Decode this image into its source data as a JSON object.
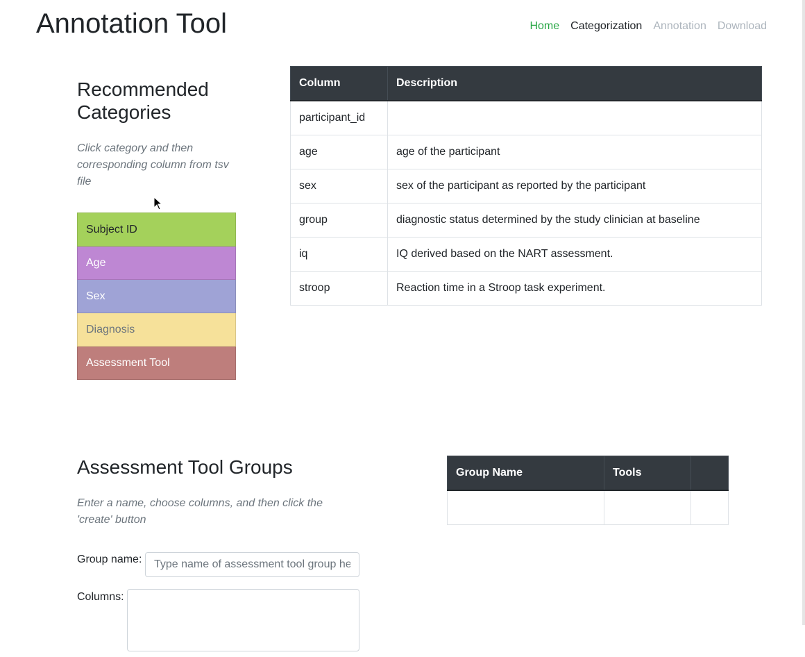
{
  "app": {
    "title": "Annotation Tool"
  },
  "nav": [
    {
      "label": "Home",
      "state": "active"
    },
    {
      "label": "Categorization",
      "state": "current"
    },
    {
      "label": "Annotation",
      "state": "disabled"
    },
    {
      "label": "Download",
      "state": "disabled"
    }
  ],
  "recommended": {
    "title": "Recommended Categories",
    "instruction": "Click category and then corresponding column from tsv file",
    "categories": [
      {
        "label": "Subject ID",
        "bg": "#a4d15b",
        "fg": "#212529"
      },
      {
        "label": "Age",
        "bg": "#be87d3",
        "fg": "#ffffff"
      },
      {
        "label": "Sex",
        "bg": "#9fa3d6",
        "fg": "#ffffff"
      },
      {
        "label": "Diagnosis",
        "bg": "#f6e19a",
        "fg": "#6c757d"
      },
      {
        "label": "Assessment Tool",
        "bg": "#be7e7c",
        "fg": "#ffffff"
      }
    ]
  },
  "columns_table": {
    "headers": [
      "Column",
      "Description"
    ],
    "rows": [
      [
        "participant_id",
        ""
      ],
      [
        "age",
        "age of the participant"
      ],
      [
        "sex",
        "sex of the participant as reported by the participant"
      ],
      [
        "group",
        "diagnostic status determined by the study clinician at baseline"
      ],
      [
        "iq",
        "IQ derived based on the NART assessment."
      ],
      [
        "stroop",
        "Reaction time in a Stroop task experiment."
      ]
    ]
  },
  "assessment_groups": {
    "title": "Assessment Tool Groups",
    "instruction": "Enter a name, choose columns, and then click the 'create' button",
    "group_name_label": "Group name:",
    "group_name_placeholder": "Type name of assessment tool group here",
    "columns_label": "Columns:",
    "table_headers": [
      "Group Name",
      "Tools",
      ""
    ]
  }
}
